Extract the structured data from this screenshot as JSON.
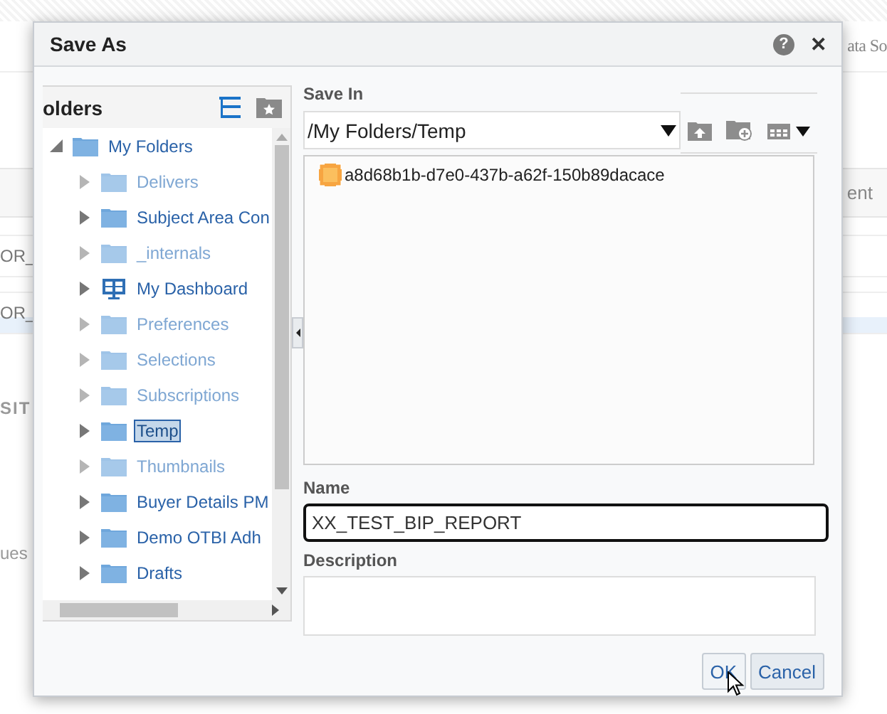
{
  "background": {
    "tab": "ata So",
    "column_header": "ent",
    "fields": [
      "OR_",
      "OR_"
    ],
    "heading": "SIT",
    "label": "ues"
  },
  "dialog": {
    "title": "Save As",
    "help": "?",
    "close": "✕",
    "folders_panel": {
      "title": "olders",
      "tree": [
        {
          "label": "My Folders",
          "kind": "folder",
          "expanded": true,
          "selected": false,
          "hidden": false,
          "children": [
            {
              "label": "Delivers",
              "kind": "folder",
              "expanded": false,
              "selected": false,
              "hidden": true
            },
            {
              "label": "Subject Area Con",
              "kind": "folder",
              "expanded": false,
              "selected": false,
              "hidden": false
            },
            {
              "label": "_internals",
              "kind": "folder",
              "expanded": false,
              "selected": false,
              "hidden": true
            },
            {
              "label": "My Dashboard",
              "kind": "dashboard",
              "expanded": false,
              "selected": false,
              "hidden": false
            },
            {
              "label": "Preferences",
              "kind": "folder",
              "expanded": false,
              "selected": false,
              "hidden": true
            },
            {
              "label": "Selections",
              "kind": "folder",
              "expanded": false,
              "selected": false,
              "hidden": true
            },
            {
              "label": "Subscriptions",
              "kind": "folder",
              "expanded": false,
              "selected": false,
              "hidden": true
            },
            {
              "label": "Temp",
              "kind": "folder",
              "expanded": false,
              "selected": true,
              "hidden": false
            },
            {
              "label": "Thumbnails",
              "kind": "folder",
              "expanded": false,
              "selected": false,
              "hidden": true
            },
            {
              "label": "Buyer Details PM",
              "kind": "folder",
              "expanded": false,
              "selected": false,
              "hidden": false
            },
            {
              "label": "Demo OTBI Adh",
              "kind": "folder",
              "expanded": false,
              "selected": false,
              "hidden": false
            },
            {
              "label": "Drafts",
              "kind": "folder",
              "expanded": false,
              "selected": false,
              "hidden": false
            }
          ]
        }
      ]
    },
    "save_in": {
      "label": "Save In",
      "value": "/My Folders/Temp"
    },
    "items": [
      {
        "name": "a8d68b1b-d7e0-437b-a62f-150b89dacace"
      }
    ],
    "name": {
      "label": "Name",
      "value": "XX_TEST_BIP_REPORT"
    },
    "description": {
      "label": "Description"
    },
    "buttons": [
      {
        "label": "OK",
        "kind": "primary"
      },
      {
        "label": "Cancel",
        "kind": "secondary"
      }
    ]
  }
}
